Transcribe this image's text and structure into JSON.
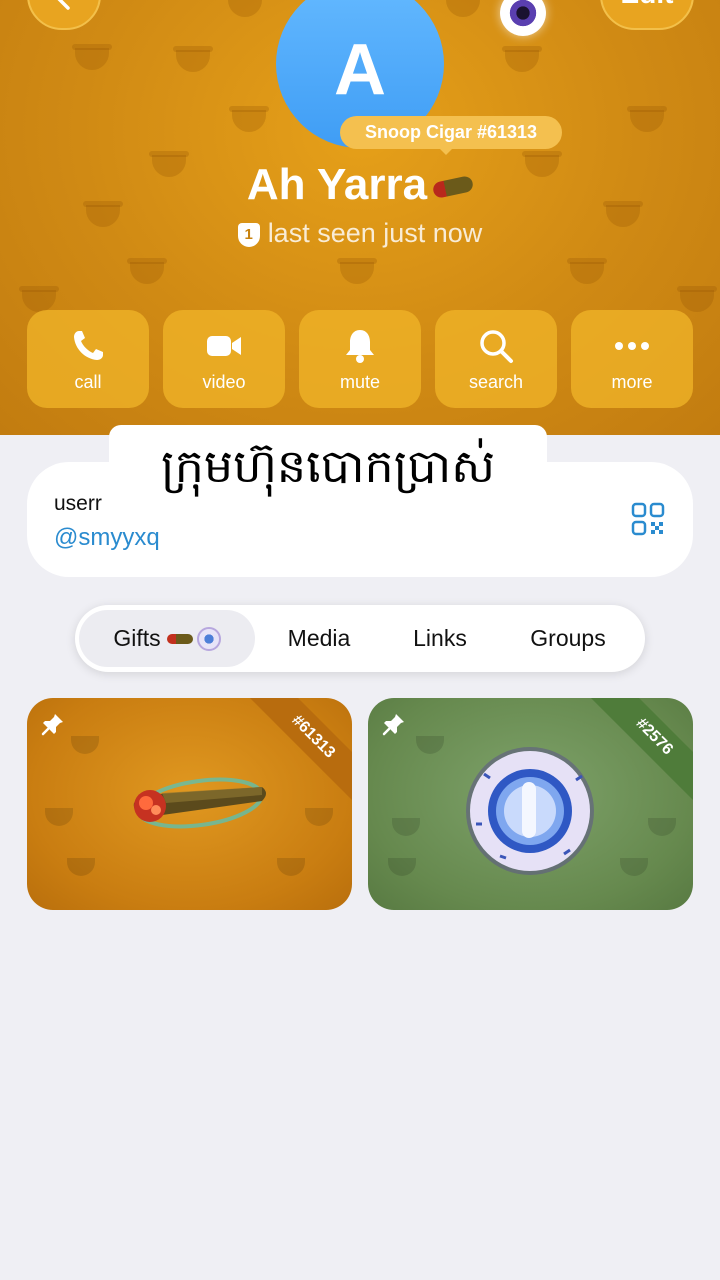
{
  "header": {
    "edit_label": "Edit",
    "avatar_letter": "A",
    "gift_pill": "Snoop Cigar #61313",
    "name": "Ah Yarra",
    "status_badge": "1",
    "status": "last seen just now"
  },
  "actions": [
    {
      "label": "call",
      "icon": "phone-icon"
    },
    {
      "label": "video",
      "icon": "video-camera-icon"
    },
    {
      "label": "mute",
      "icon": "bell-icon"
    },
    {
      "label": "search",
      "icon": "search-icon"
    },
    {
      "label": "more",
      "icon": "more-dots-icon"
    }
  ],
  "caption": "ក្រុមហ៊ុនបោកប្រាស់",
  "info": {
    "username_label": "userr",
    "handle": "@smyyxq"
  },
  "tabs": [
    "Gifts",
    "Media",
    "Links",
    "Groups"
  ],
  "gifts": [
    {
      "number": "#61313",
      "name": "Snoop Cigar",
      "color": "#d08a14"
    },
    {
      "number": "#2576",
      "color": "#66894e"
    }
  ],
  "colors": {
    "header_bg": "#d08a14",
    "avatar": "#3f9df5",
    "link": "#2a8bcf"
  }
}
